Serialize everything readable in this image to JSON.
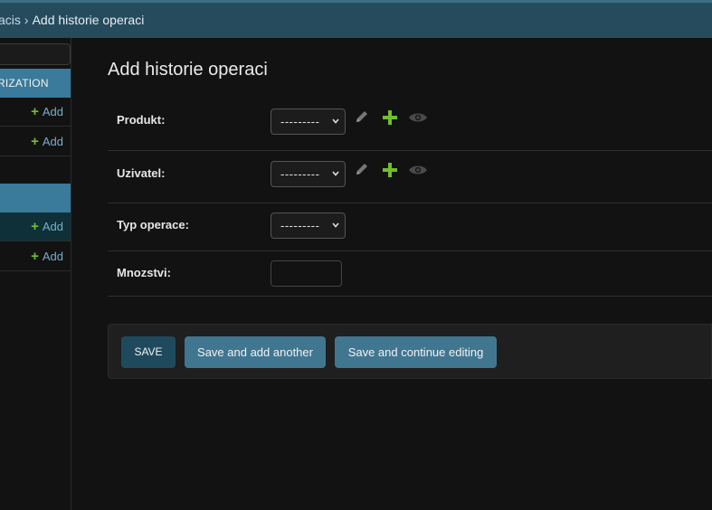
{
  "breadcrumbs": {
    "parent": "acis",
    "separator": "›",
    "current": "Add historie operaci"
  },
  "sidebar": {
    "module_caption": "RIZATION",
    "add_label": "Add"
  },
  "main": {
    "title": "Add historie operaci",
    "fields": {
      "produkt": {
        "label": "Produkt:",
        "value": "---------"
      },
      "uzivatel": {
        "label": "Uzivatel:",
        "value": "---------"
      },
      "typ_operace": {
        "label": "Typ operace:",
        "value": "---------"
      },
      "mnozstvi": {
        "label": "Mnozstvi:",
        "value": ""
      }
    }
  },
  "submit": {
    "save": "SAVE",
    "save_add_another": "Save and add another",
    "save_continue": "Save and continue editing"
  },
  "colors": {
    "header_bg": "#264b5d",
    "accent": "#417690",
    "add_green": "#70bf2b"
  },
  "icons": {
    "change": "pencil-icon",
    "add": "plus-icon",
    "view": "eye-icon"
  }
}
